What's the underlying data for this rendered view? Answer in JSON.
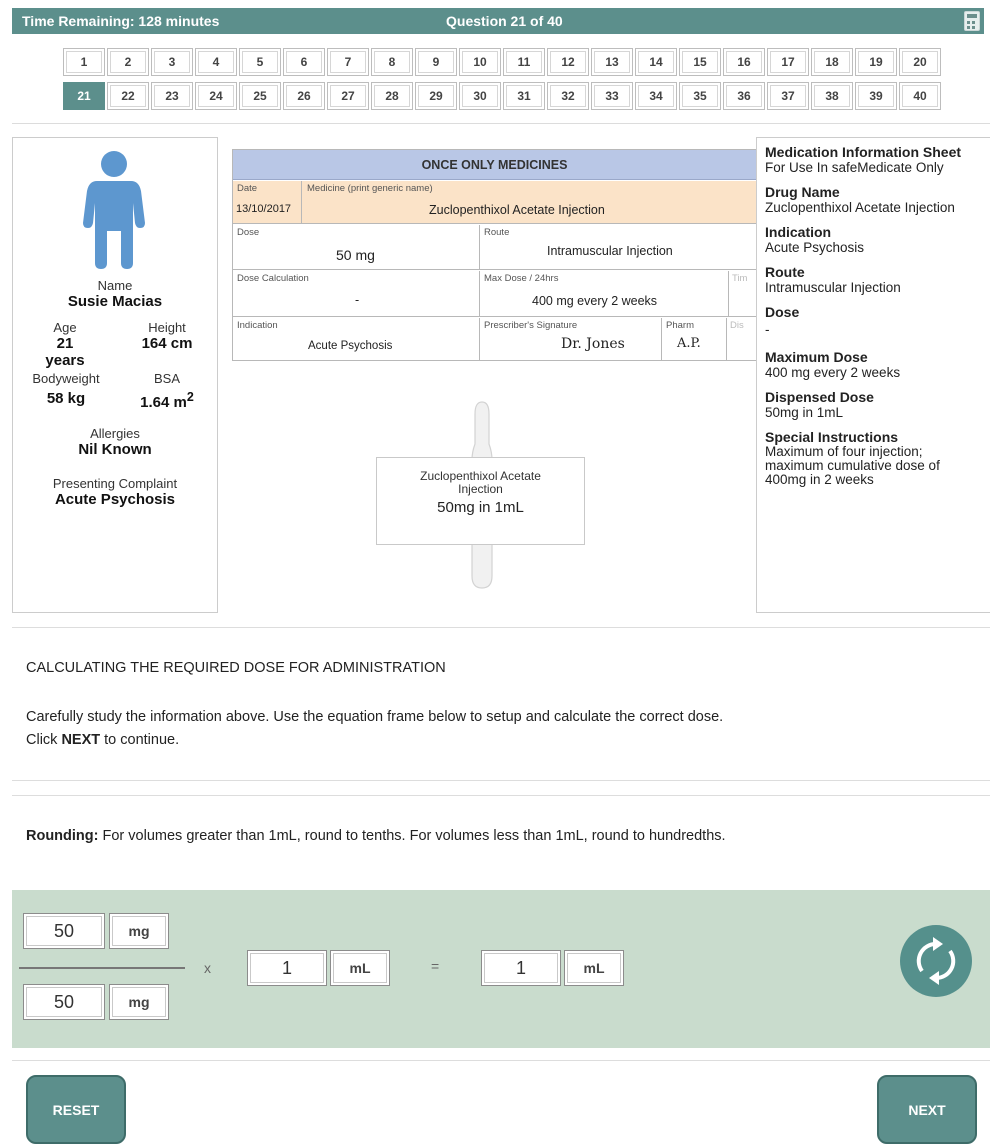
{
  "header": {
    "time_remaining": "Time Remaining: 128 minutes",
    "question_counter": "Question 21 of 40",
    "calculator_icon": "calculator-icon"
  },
  "question_nav": {
    "row1": [
      "1",
      "2",
      "3",
      "4",
      "5",
      "6",
      "7",
      "8",
      "9",
      "10",
      "11",
      "12",
      "13",
      "14",
      "15",
      "16",
      "17",
      "18",
      "19",
      "20"
    ],
    "row2": [
      "21",
      "22",
      "23",
      "24",
      "25",
      "26",
      "27",
      "28",
      "29",
      "30",
      "31",
      "32",
      "33",
      "34",
      "35",
      "36",
      "37",
      "38",
      "39",
      "40"
    ],
    "active": "21"
  },
  "patient": {
    "icon": "person-icon",
    "name_label": "Name",
    "name": "Susie Macias",
    "age_label": "Age",
    "age": "21 years",
    "height_label": "Height",
    "height": "164 cm",
    "bodyweight_label": "Bodyweight",
    "bodyweight": "58 kg",
    "bsa_label": "BSA",
    "bsa": "1.64 m",
    "bsa_sup": "2",
    "allergies_label": "Allergies",
    "allergies": "Nil Known",
    "complaint_label": "Presenting Complaint",
    "complaint": "Acute Psychosis"
  },
  "chart": {
    "title": "ONCE ONLY MEDICINES",
    "date_label": "Date",
    "date": "13/10/2017",
    "medicine_label": "Medicine (print generic name)",
    "medicine": "Zuclopenthixol Acetate Injection",
    "dose_label": "Dose",
    "dose": "50 mg",
    "route_label": "Route",
    "route": "Intramuscular Injection",
    "dose_calc_label": "Dose Calculation",
    "dose_calc": "-",
    "max_dose_label": "Max Dose / 24hrs",
    "max_dose": "400 mg every 2 weeks",
    "time_label": "Tim",
    "indication_label": "Indication",
    "indication": "Acute Psychosis",
    "prescriber_label": "Prescriber's Signature",
    "prescriber": "Dr. Jones",
    "pharm_label": "Pharm",
    "pharm": "A.P.",
    "dis_label": "Dis"
  },
  "ampoule": {
    "line1": "Zuclopenthixol Acetate",
    "line2": "Injection",
    "strength": "50mg in 1mL"
  },
  "info_sheet": {
    "title": "Medication Information Sheet",
    "subtitle": "For Use In safeMedicate Only",
    "drug_name_label": "Drug Name",
    "drug_name": "Zuclopenthixol Acetate Injection",
    "indication_label": "Indication",
    "indication": "Acute Psychosis",
    "route_label": "Route",
    "route": "Intramuscular Injection",
    "dose_label": "Dose",
    "dose": "-",
    "max_dose_label": "Maximum Dose",
    "max_dose": "400 mg every 2 weeks",
    "dispensed_label": "Dispensed Dose",
    "dispensed": "50mg in 1mL",
    "special_label": "Special Instructions",
    "special_1": "Maximum of four injection;",
    "special_2": "maximum cumulative dose of",
    "special_3": "400mg in 2 weeks"
  },
  "instructions": {
    "heading": "CALCULATING THE REQUIRED DOSE FOR ADMINISTRATION",
    "line1": "Carefully study the information above. Use the equation frame below to setup and calculate the correct dose.",
    "line2_pre": "Click ",
    "line2_bold": "NEXT",
    "line2_post": " to continue."
  },
  "rounding": {
    "label": "Rounding:",
    "text": " For volumes greater than 1mL, round to tenths. For volumes less than 1mL, round to hundredths."
  },
  "equation": {
    "numerator_value": "50",
    "numerator_unit": "mg",
    "denominator_value": "50",
    "denominator_unit": "mg",
    "times": "x",
    "multiplier_value": "1",
    "multiplier_unit": "mL",
    "equals": "=",
    "result_value": "1",
    "result_unit": "mL",
    "refresh_icon": "refresh-icon"
  },
  "buttons": {
    "reset": "RESET",
    "next": "NEXT"
  }
}
